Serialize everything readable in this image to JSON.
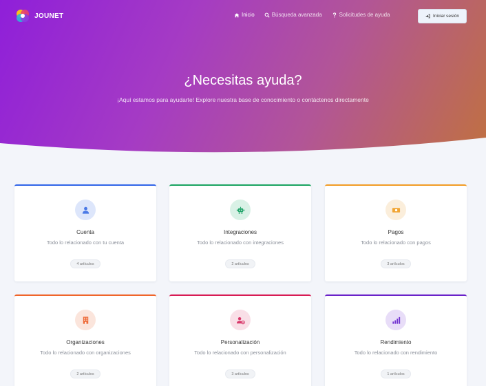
{
  "brand": {
    "name": "JOUNET"
  },
  "nav": {
    "links": [
      {
        "label": "Inicio",
        "icon": "home-icon"
      },
      {
        "label": "Búsqueda avanzada",
        "icon": "search-icon"
      },
      {
        "label": "Solicitudes de ayuda",
        "icon": "question-icon"
      }
    ],
    "login_label": "Iniciar sesión"
  },
  "hero": {
    "title": "¿Necesitas ayuda?",
    "subtitle": "¡Aquí estamos para ayudarte! Explore nuestra base de conocimiento o contáctenos directamente"
  },
  "categories": [
    {
      "title": "Cuenta",
      "desc": "Todo lo relacionado con tu cuenta",
      "count": "4 artículos",
      "icon": "user-icon",
      "accent": "#2f63e8",
      "icon_bg": "#dde6fb",
      "icon_fg": "#4a79e6"
    },
    {
      "title": "Integraciones",
      "desc": "Todo lo relacionado con integraciones",
      "count": "2 artículos",
      "icon": "robot-icon",
      "accent": "#18a35f",
      "icon_bg": "#d9f1e6",
      "icon_fg": "#21a46a"
    },
    {
      "title": "Pagos",
      "desc": "Todo lo relacionado con pagos",
      "count": "3 artículos",
      "icon": "money-icon",
      "accent": "#f29b23",
      "icon_bg": "#fbeedb",
      "icon_fg": "#f1a534"
    },
    {
      "title": "Organizaciones",
      "desc": "Todo lo relacionado con organizaciones",
      "count": "2 artículos",
      "icon": "building-icon",
      "accent": "#f0652a",
      "icon_bg": "#fbe5dc",
      "icon_fg": "#ee6c3a"
    },
    {
      "title": "Personalización",
      "desc": "Todo lo relacionado con personalización",
      "count": "3 artículos",
      "icon": "user-gear-icon",
      "accent": "#d81b54",
      "icon_bg": "#f9dfe7",
      "icon_fg": "#d8386a"
    },
    {
      "title": "Rendimiento",
      "desc": "Todo lo relacionado con rendimiento",
      "count": "1 artículos",
      "icon": "signal-icon",
      "accent": "#6a22c9",
      "icon_bg": "#e8ddf8",
      "icon_fg": "#7030d0"
    }
  ]
}
